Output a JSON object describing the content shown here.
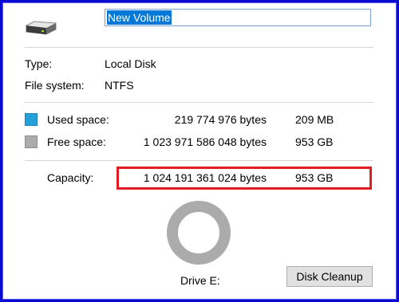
{
  "header": {
    "drive_icon": "drive-icon",
    "volume_name": "New Volume"
  },
  "info": {
    "type_label": "Type:",
    "type_value": "Local Disk",
    "fs_label": "File system:",
    "fs_value": "NTFS"
  },
  "space": {
    "used": {
      "label": "Used space:",
      "bytes": "219 774 976 bytes",
      "size": "209 MB",
      "color": "#26a0da"
    },
    "free": {
      "label": "Free space:",
      "bytes": "1 023 971 586 048 bytes",
      "size": "953 GB",
      "color": "#ababab"
    },
    "capacity": {
      "label": "Capacity:",
      "bytes": "1 024 191 361 024 bytes",
      "size": "953 GB"
    }
  },
  "usage": {
    "used_fraction": 0.0002
  },
  "footer": {
    "drive_label": "Drive E:",
    "cleanup_button": "Disk Cleanup"
  },
  "colors": {
    "frame": "#0a0ad0",
    "highlight": "#e31b23",
    "selection": "#0078d7"
  }
}
